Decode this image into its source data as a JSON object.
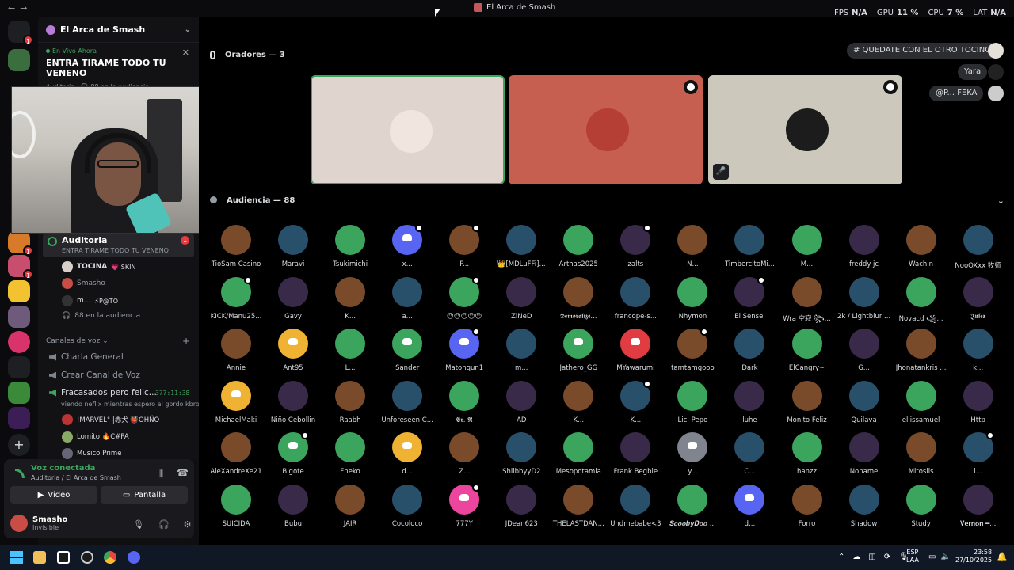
{
  "window": {
    "title": "El Arca de Smash"
  },
  "stats": [
    {
      "label": "FPS",
      "value": "N/A"
    },
    {
      "label": "GPU",
      "value": "11 %"
    },
    {
      "label": "CPU",
      "value": "7 %"
    },
    {
      "label": "LAT",
      "value": "N/A"
    }
  ],
  "sidebar": {
    "server_name": "El Arca de Smash",
    "live": {
      "tag": "En Vivo Ahora",
      "title": "ENTRA TIRAME TODO TU VENENO",
      "sub": "Auditoria · 🎧 88 en la audiencia"
    },
    "stage": {
      "name": "Auditoria",
      "sub": "ENTRA TIRAME TODO TU VENENO",
      "badge": "1"
    },
    "stage_members": [
      {
        "name": "TOCINA",
        "tag": "💗 SKIN"
      },
      {
        "name": "Smasho",
        "tag": ""
      },
      {
        "name": "m...",
        "tag": "⚡P@TO"
      },
      {
        "name": "88 en la audiencia",
        "tag": ""
      }
    ],
    "voice_category": "Canales de voz",
    "voice_channels": [
      {
        "name": "Charla General"
      },
      {
        "name": "Crear Canal de Voz"
      },
      {
        "name": "Fracasados pero felic..."
      }
    ],
    "voice_timer": "377:11:38",
    "voice_sub": "viendo neflix mientras espero al gordo kbro💀",
    "voice_members": [
      {
        "name": "!MARVEL° |赤犬 👹OHÑO"
      },
      {
        "name": "Lomito 🔥C#PA"
      },
      {
        "name": "Musico Prime"
      }
    ]
  },
  "voice_panel": {
    "status": "Voz conectada",
    "location": "Auditoria / El Arca de Smash",
    "video_label": "Video",
    "screen_label": "Pantalla"
  },
  "user": {
    "name": "Smasho",
    "status": "Invisible"
  },
  "stage_view": {
    "speakers_header": "Oradores — 3",
    "chips": [
      {
        "text": "# QUEDATE CON EL OTRO TOCINO"
      },
      {
        "text": "Yara"
      },
      {
        "text": "@P... FEKA"
      }
    ],
    "audience_header": "Audiencia — 88",
    "audience": [
      "TioSam Casino",
      "Maravi",
      "Tsukimichi",
      "x...",
      "P...",
      "👑[MDLuFFi]...",
      "Arthas2025",
      "zalts",
      "N...",
      "TimbercitoMi...",
      "M...",
      "freddy jc",
      "Wachin",
      "NooOXxx 牧师",
      "KICK/Manu25...",
      "Gavy",
      "K...",
      "a...",
      "😶😶😶😶😶",
      "ZiNeD",
      "𝕯𝖊𝖒𝖔𝖗𝖆𝖑𝖎𝖟𝖊...",
      "francope-s...",
      "Nhymon",
      "El Sensei",
      "Wra 空寂 ꧂...",
      "2k / Lightblur ...",
      "Novacd ꧁...",
      "𝕵𝖚𝖑𝖊𝖝",
      "Annie",
      "Ant95",
      "L...",
      "Sander",
      "Matonqun1",
      "m...",
      "Jathero_GG",
      "MYawarumi",
      "tamtamgooo",
      "Dark",
      "ElCangry~",
      "G...",
      "Jhonatankris ...",
      "k...",
      "MichaelMaki",
      "Niño Cebollin",
      "Raabh",
      "Unforeseen C...",
      "𝕰𝖗. 𝕽",
      "AD",
      "K...",
      "K...",
      "Lic. Pepo",
      "luhe",
      "Monito Feliz",
      "Quilava",
      "ellissamuel",
      "Http",
      "AleXandreXe21",
      "Bigote",
      "Fneko",
      "d...",
      "Z...",
      "ShiibbyyD2",
      "Mesopotamia",
      "Frank Begbie",
      "y...",
      "C...",
      "hanzz",
      "Noname",
      "Mitosiis",
      "l...",
      "SUICIDA",
      "Bubu",
      "JAIR",
      "Cocoloco",
      "777Y",
      "JDean623",
      "THELASTDAN...",
      "Undmebabe<3",
      "𝑺𝒄𝒐𝒐𝒃𝒚𝑫𝒐𝒐 ...",
      "d...",
      "Forro",
      "Shadow",
      "Study",
      "𝐕𝐞𝐫𝐧𝐨𝐧 ━..."
    ]
  },
  "taskbar": {
    "lang": "ESP",
    "layout": "LAA",
    "time": "23:58",
    "date": "27/10/2025"
  },
  "colors": {
    "accent": "#5865f2",
    "online": "#3ba55d",
    "danger": "#e03c41"
  }
}
